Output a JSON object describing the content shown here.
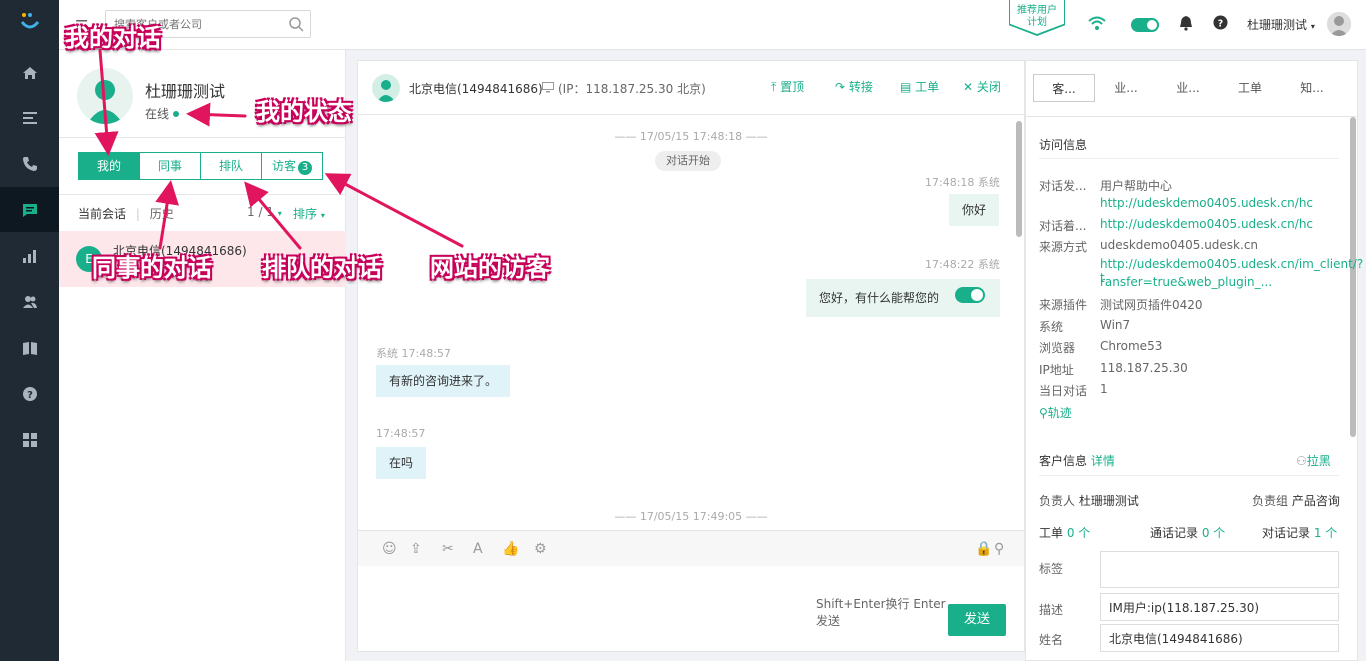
{
  "topbar": {
    "search_placeholder": "搜索客户或者公司",
    "promo": "推荐用户\n计划",
    "username": "杜珊珊测试"
  },
  "agent": {
    "name": "杜珊珊测试",
    "status": "在线"
  },
  "tabs": [
    {
      "label": "我的"
    },
    {
      "label": "同事"
    },
    {
      "label": "排队"
    },
    {
      "label": "访客",
      "badge": "3"
    }
  ],
  "session_bar": {
    "current": "当前会话",
    "history": "历史",
    "page": "1 / 1",
    "sort": "排序"
  },
  "conversation_item": {
    "name": "北京电信(1494841686)",
    "avatar_char": "E"
  },
  "chat_header": {
    "title": "北京电信(1494841686)",
    "ip": "(IP：118.187.25.30 北京)",
    "actions": [
      "置顶",
      "转接",
      "工单",
      "关闭"
    ]
  },
  "chat": {
    "timestamp1": "—— 17/05/15 17:48:18 ——",
    "start_label": "对话开始",
    "msg1_meta": "17:48:18 系统",
    "msg1": "你好",
    "msg2_meta": "17:48:22 系统",
    "msg2": "您好，有什么能帮您的",
    "msg3_meta": "系统 17:48:57",
    "msg3": "有新的咨询进来了。",
    "msg4_meta": "17:48:57",
    "msg4": "在吗",
    "timestamp2": "—— 17/05/15 17:49:05 ——"
  },
  "composer": {
    "hint": "Shift+Enter换行 Enter发送",
    "send": "发送"
  },
  "right_tabs": [
    "客...",
    "业...",
    "业...",
    "工单",
    "知..."
  ],
  "visit_info": {
    "title": "访问信息",
    "rows": [
      {
        "k": "对话发...",
        "v": "用户帮助中心"
      },
      {
        "k": "",
        "v": "http://udeskdemo0405.udesk.cn/hc"
      },
      {
        "k": "对话着...",
        "v": "http://udeskdemo0405.udesk.cn/hc"
      },
      {
        "k": "来源方式",
        "v": "udeskdemo0405.udesk.cn"
      },
      {
        "k": "",
        "v": "http://udeskdemo0405.udesk.cn/im_client/?t"
      },
      {
        "k": "",
        "v": "ransfer=true&web_plugin_..."
      },
      {
        "k": "来源插件",
        "v": "测试网页插件0420"
      },
      {
        "k": "系统",
        "v": "Win7"
      },
      {
        "k": "浏览器",
        "v": "Chrome53"
      },
      {
        "k": "IP地址",
        "v": "118.187.25.30"
      },
      {
        "k": "当日对话",
        "v": "1"
      }
    ],
    "track": "轨迹"
  },
  "customer_info": {
    "title": "客户信息",
    "detail": "详情",
    "block": "拉黑",
    "owner_label": "负责人",
    "owner": "杜珊珊测试",
    "group_label": "负责组",
    "group": "产品咨询",
    "tickets_label": "工单",
    "tickets": "0 个",
    "calls_label": "通话记录",
    "calls": "0 个",
    "chats_label": "对话记录",
    "chats": "1 个",
    "tag_label": "标签",
    "desc_label": "描述",
    "desc": "IM用户:ip(118.187.25.30)",
    "name_label": "姓名",
    "name": "北京电信(1494841686)"
  },
  "annotations": {
    "my_chats": "我的对话",
    "my_status": "我的状态",
    "colleague_chats": "同事的对话",
    "queue_chats": "排队的对话",
    "site_visitors": "网站的访客"
  },
  "colors": {
    "accent": "#1aaf8b",
    "nav": "#1f2a35",
    "annotation": "#e0155d"
  }
}
